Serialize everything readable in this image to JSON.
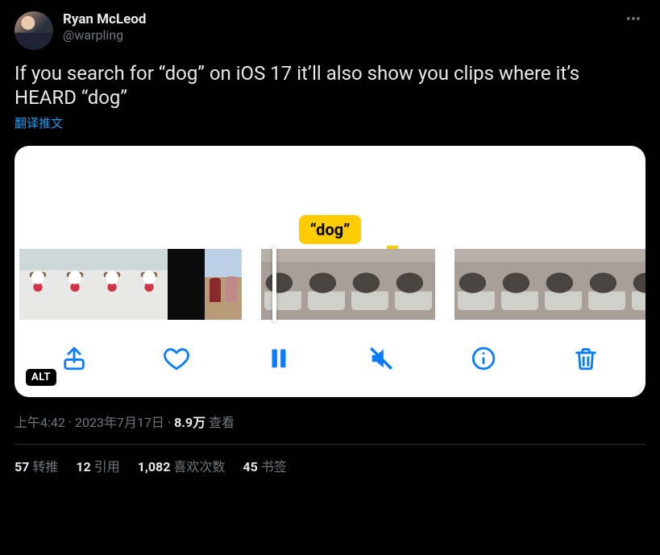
{
  "author": {
    "display_name": "Ryan McLeod",
    "handle": "@warpling"
  },
  "body": "If you search for “dog” on iOS 17 it’ll also show you clips where it’s HEARD “dog”",
  "translate": "翻译推文",
  "media": {
    "tooltip": "“dog”",
    "alt_badge": "ALT",
    "icons": {
      "share": "share-icon",
      "heart": "heart-icon",
      "pause": "pause-icon",
      "mute": "speaker-muted-icon",
      "info": "info-icon",
      "trash": "trash-icon"
    }
  },
  "meta": {
    "time": "上午4:42",
    "date": "2023年7月17日",
    "sep": " · ",
    "views_count": "8.9万",
    "views_label": " 查看"
  },
  "stats": {
    "retweets_count": "57",
    "retweets_label": "转推",
    "quotes_count": "12",
    "quotes_label": "引用",
    "likes_count": "1,082",
    "likes_label": "喜欢次数",
    "bookmarks_count": "45",
    "bookmarks_label": "书签"
  }
}
